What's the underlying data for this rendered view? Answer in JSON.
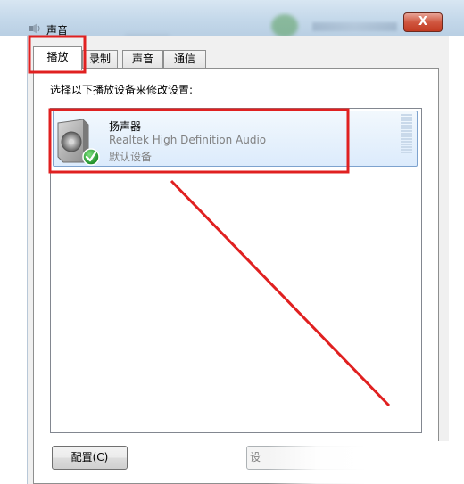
{
  "window": {
    "title": "声音",
    "close_label": "X"
  },
  "tabs": [
    {
      "label": "播放",
      "active": true
    },
    {
      "label": "录制",
      "active": false
    },
    {
      "label": "声音",
      "active": false
    },
    {
      "label": "通信",
      "active": false
    }
  ],
  "panel": {
    "instruction": "选择以下播放设备来修改设置:"
  },
  "devices": [
    {
      "name": "扬声器",
      "description": "Realtek High Definition Audio",
      "status": "默认设备",
      "icon": "speaker-icon",
      "badge_icon": "default-check-icon"
    }
  ],
  "buttons": {
    "configure": "配置(C)",
    "set_default_partial": "设"
  },
  "annotation": {
    "color": "#e02020"
  }
}
